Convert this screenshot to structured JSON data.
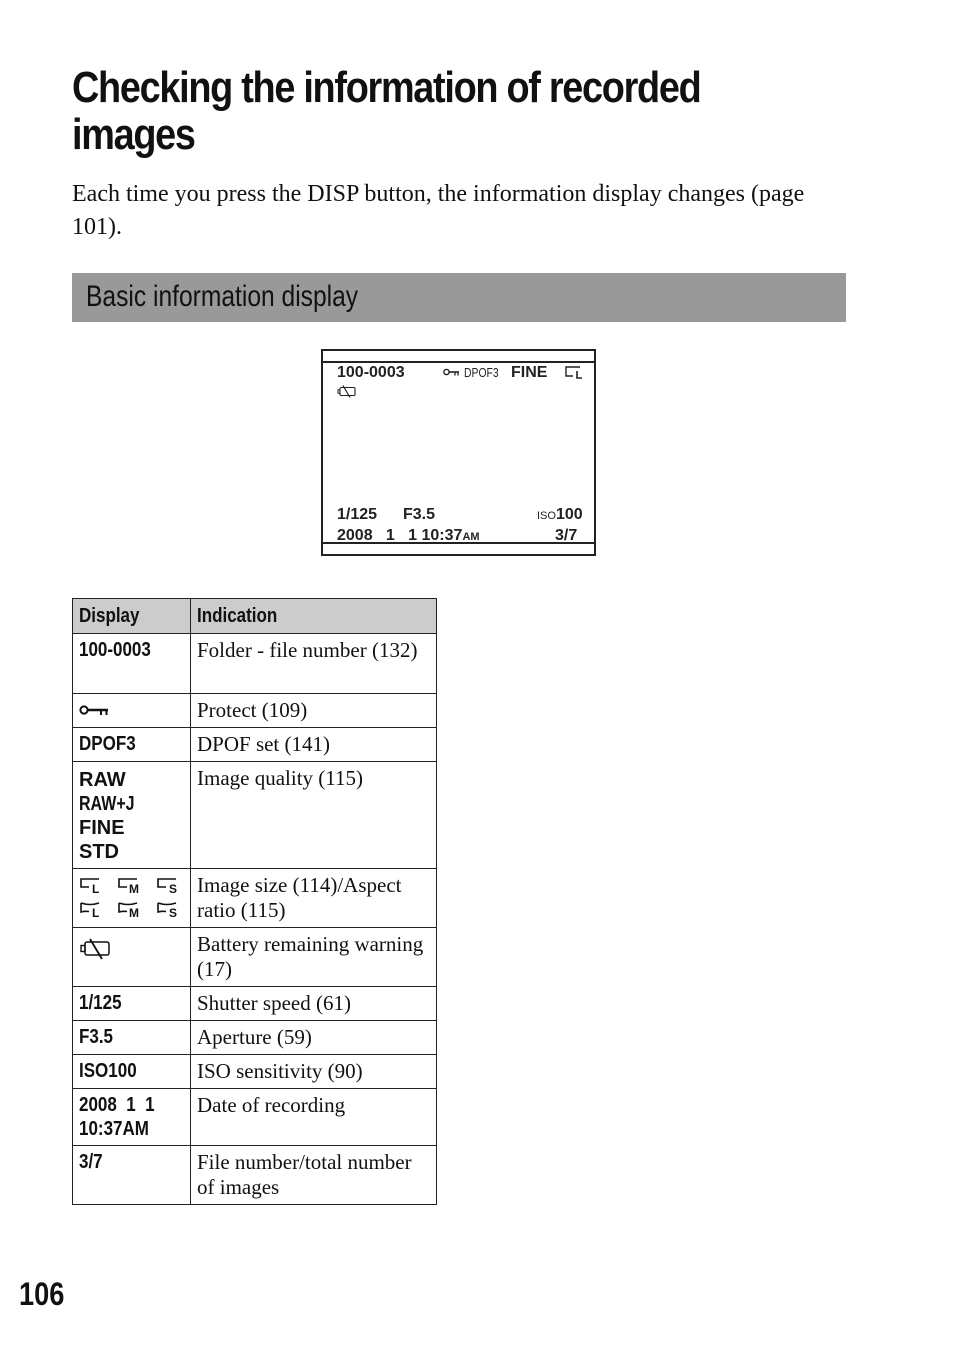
{
  "page": {
    "title": "Checking the information of recorded images",
    "intro": "Each time you press the DISP button, the information display changes (page 101).",
    "section_heading": "Basic information display",
    "page_number": "106"
  },
  "lcd": {
    "folder_file": "100-0003",
    "protect_icon": "key-icon",
    "dpof": "DPOF3",
    "quality": "FINE",
    "image_size_icon": "image-size-large-icon",
    "battery_icon": "battery-warning-icon",
    "shutter": "1/125",
    "aperture": "F3.5",
    "iso_label": "ISO",
    "iso_value": "100",
    "date": "2008   1   1 10:37",
    "ampm": "AM",
    "file_count": "3/7"
  },
  "table": {
    "headers": [
      "Display",
      "Indication"
    ],
    "rows": [
      {
        "display": "100-0003",
        "indication": "Folder - file number (132)"
      },
      {
        "display_icon": "key-icon",
        "indication": "Protect (109)"
      },
      {
        "display": "DPOF3",
        "indication": "DPOF set (141)"
      },
      {
        "display_lines": [
          "RAW",
          "RAW+J",
          "FINE",
          "STD"
        ],
        "indication": "Image quality (115)"
      },
      {
        "display_icons": [
          "size-L-icon",
          "size-M-icon",
          "size-S-icon",
          "size-wide-L-icon",
          "size-wide-M-icon",
          "size-wide-S-icon"
        ],
        "size_letters": [
          "L",
          "M",
          "S"
        ],
        "indication": "Image size (114)/Aspect ratio (115)"
      },
      {
        "display_icon": "battery-warning-icon",
        "indication": "Battery remaining warning (17)"
      },
      {
        "display": "1/125",
        "indication": "Shutter speed (61)"
      },
      {
        "display": "F3.5",
        "indication": "Aperture (59)"
      },
      {
        "display": "ISO100",
        "indication": "ISO sensitivity (90)"
      },
      {
        "display_lines": [
          "2008  1  1",
          "10:37AM"
        ],
        "indication": "Date of recording"
      },
      {
        "display": "3/7",
        "indication": "File number/total number of images"
      }
    ]
  }
}
